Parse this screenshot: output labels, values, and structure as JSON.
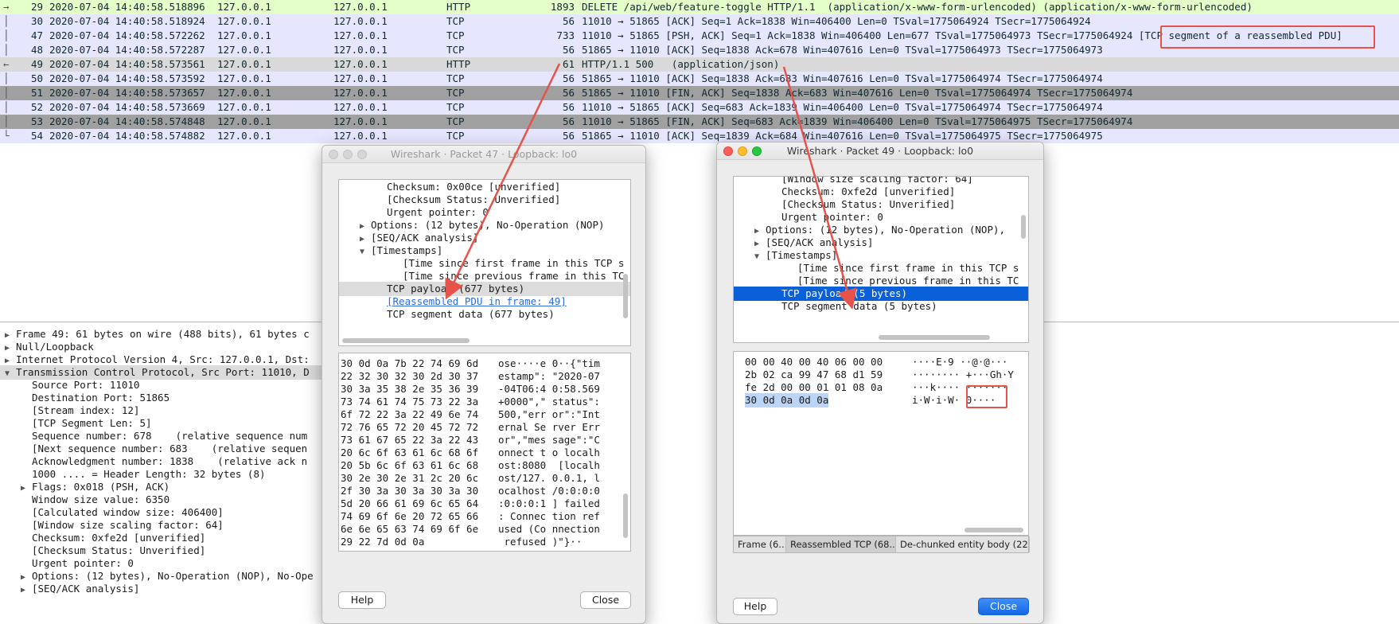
{
  "packets": [
    {
      "no": "29",
      "time": "2020-07-04 14:40:58.518896",
      "src": "127.0.0.1",
      "dst": "127.0.0.1",
      "proto": "HTTP",
      "len": "1893",
      "info": "DELETE /api/web/feature-toggle HTTP/1.1  (application/x-www-form-urlencoded) (application/x-www-form-urlencoded)",
      "bg": "#e4ffc7",
      "fg": "#12272e",
      "rel": "→"
    },
    {
      "no": "30",
      "time": "2020-07-04 14:40:58.518924",
      "src": "127.0.0.1",
      "dst": "127.0.0.1",
      "proto": "TCP",
      "len": "56",
      "info": "11010 → 51865 [ACK] Seq=1 Ack=1838 Win=406400 Len=0 TSval=1775064924 TSecr=1775064924",
      "bg": "#e7e6ff",
      "fg": "#12272e",
      "rel": "│"
    },
    {
      "no": "47",
      "time": "2020-07-04 14:40:58.572262",
      "src": "127.0.0.1",
      "dst": "127.0.0.1",
      "proto": "TCP",
      "len": "733",
      "info": "11010 → 51865 [PSH, ACK] Seq=1 Ack=1838 Win=406400 Len=677 TSval=1775064973 TSecr=1775064924 [TCP segment of a reassembled PDU]",
      "bg": "#e7e6ff",
      "fg": "#12272e",
      "rel": "│"
    },
    {
      "no": "48",
      "time": "2020-07-04 14:40:58.572287",
      "src": "127.0.0.1",
      "dst": "127.0.0.1",
      "proto": "TCP",
      "len": "56",
      "info": "51865 → 11010 [ACK] Seq=1838 Ack=678 Win=407616 Len=0 TSval=1775064973 TSecr=1775064973",
      "bg": "#e7e6ff",
      "fg": "#12272e",
      "rel": "│"
    },
    {
      "no": "49",
      "time": "2020-07-04 14:40:58.573561",
      "src": "127.0.0.1",
      "dst": "127.0.0.1",
      "proto": "HTTP",
      "len": "61",
      "info": "HTTP/1.1 500   (application/json)",
      "bg": "#d9d9d9",
      "fg": "#12272e",
      "rel": "←"
    },
    {
      "no": "50",
      "time": "2020-07-04 14:40:58.573592",
      "src": "127.0.0.1",
      "dst": "127.0.0.1",
      "proto": "TCP",
      "len": "56",
      "info": "51865 → 11010 [ACK] Seq=1838 Ack=683 Win=407616 Len=0 TSval=1775064974 TSecr=1775064974",
      "bg": "#e7e6ff",
      "fg": "#12272e",
      "rel": "│"
    },
    {
      "no": "51",
      "time": "2020-07-04 14:40:58.573657",
      "src": "127.0.0.1",
      "dst": "127.0.0.1",
      "proto": "TCP",
      "len": "56",
      "info": "51865 → 11010 [FIN, ACK] Seq=1838 Ack=683 Win=407616 Len=0 TSval=1775064974 TSecr=1775064974",
      "bg": "#a0a0a0",
      "fg": "#12272e",
      "rel": "│"
    },
    {
      "no": "52",
      "time": "2020-07-04 14:40:58.573669",
      "src": "127.0.0.1",
      "dst": "127.0.0.1",
      "proto": "TCP",
      "len": "56",
      "info": "11010 → 51865 [ACK] Seq=683 Ack=1839 Win=406400 Len=0 TSval=1775064974 TSecr=1775064974",
      "bg": "#e7e6ff",
      "fg": "#12272e",
      "rel": "│"
    },
    {
      "no": "53",
      "time": "2020-07-04 14:40:58.574848",
      "src": "127.0.0.1",
      "dst": "127.0.0.1",
      "proto": "TCP",
      "len": "56",
      "info": "11010 → 51865 [FIN, ACK] Seq=683 Ack=1839 Win=406400 Len=0 TSval=1775064975 TSecr=1775064974",
      "bg": "#a0a0a0",
      "fg": "#12272e",
      "rel": "│"
    },
    {
      "no": "54",
      "time": "2020-07-04 14:40:58.574882",
      "src": "127.0.0.1",
      "dst": "127.0.0.1",
      "proto": "TCP",
      "len": "56",
      "info": "51865 → 11010 [ACK] Seq=1839 Ack=684 Win=407616 Len=0 TSval=1775064975 TSecr=1775064975",
      "bg": "#e7e6ff",
      "fg": "#12272e",
      "rel": "└"
    }
  ],
  "details": [
    {
      "text": "Frame 49: 61 bytes on wire (488 bits), 61 bytes c",
      "tri": "▶",
      "indent": 0
    },
    {
      "text": "Null/Loopback",
      "tri": "▶",
      "indent": 0
    },
    {
      "text": "Internet Protocol Version 4, Src: 127.0.0.1, Dst:",
      "tri": "▶",
      "indent": 0
    },
    {
      "text": "Transmission Control Protocol, Src Port: 11010, D",
      "tri": "▼",
      "indent": 0,
      "sel": true
    },
    {
      "text": "Source Port: 11010",
      "tri": "",
      "indent": 1
    },
    {
      "text": "Destination Port: 51865",
      "tri": "",
      "indent": 1
    },
    {
      "text": "[Stream index: 12]",
      "tri": "",
      "indent": 1
    },
    {
      "text": "[TCP Segment Len: 5]",
      "tri": "",
      "indent": 1
    },
    {
      "text": "Sequence number: 678    (relative sequence num",
      "tri": "",
      "indent": 1
    },
    {
      "text": "[Next sequence number: 683    (relative sequen",
      "tri": "",
      "indent": 1
    },
    {
      "text": "Acknowledgment number: 1838    (relative ack n",
      "tri": "",
      "indent": 1
    },
    {
      "text": "1000 .... = Header Length: 32 bytes (8)",
      "tri": "",
      "indent": 1
    },
    {
      "text": "Flags: 0x018 (PSH, ACK)",
      "tri": "▶",
      "indent": 1
    },
    {
      "text": "Window size value: 6350",
      "tri": "",
      "indent": 1
    },
    {
      "text": "[Calculated window size: 406400]",
      "tri": "",
      "indent": 1
    },
    {
      "text": "[Window size scaling factor: 64]",
      "tri": "",
      "indent": 1
    },
    {
      "text": "Checksum: 0xfe2d [unverified]",
      "tri": "",
      "indent": 1
    },
    {
      "text": "[Checksum Status: Unverified]",
      "tri": "",
      "indent": 1
    },
    {
      "text": "Urgent pointer: 0",
      "tri": "",
      "indent": 1
    },
    {
      "text": "Options: (12 bytes), No-Operation (NOP), No-Ope",
      "tri": "▶",
      "indent": 1
    },
    {
      "text": "[SEQ/ACK analysis]",
      "tri": "▶",
      "indent": 1
    }
  ],
  "dialog47": {
    "title": "Wireshark · Packet 47 · Loopback: lo0",
    "tree": [
      {
        "text": "Checksum: 0x00ce [unverified]",
        "tri": "",
        "indent": 2
      },
      {
        "text": "[Checksum Status: Unverified]",
        "tri": "",
        "indent": 2
      },
      {
        "text": "Urgent pointer: 0",
        "tri": "",
        "indent": 2
      },
      {
        "text": "Options: (12 bytes), No-Operation (NOP)",
        "tri": "▶",
        "indent": 1
      },
      {
        "text": "[SEQ/ACK analysis]",
        "tri": "▶",
        "indent": 1
      },
      {
        "text": "[Timestamps]",
        "tri": "▼",
        "indent": 1
      },
      {
        "text": "[Time since first frame in this TCP s",
        "tri": "",
        "indent": 3
      },
      {
        "text": "[Time since previous frame in this TC",
        "tri": "",
        "indent": 3
      },
      {
        "text": "TCP payload (677 bytes)",
        "tri": "",
        "indent": 2,
        "hl": "grey"
      },
      {
        "text": "[Reassembled PDU in frame: 49]",
        "tri": "",
        "indent": 2,
        "link": true
      },
      {
        "text": "TCP segment data (677 bytes)",
        "tri": "",
        "indent": 2
      }
    ],
    "hex": [
      "30 0d 0a 7b 22 74 69 6d",
      "22 32 30 32 30 2d 30 37",
      "30 3a 35 38 2e 35 36 39",
      "73 74 61 74 75 73 22 3a",
      "6f 72 22 3a 22 49 6e 74",
      "72 76 65 72 20 45 72 72",
      "73 61 67 65 22 3a 22 43",
      "20 6c 6f 63 61 6c 68 6f",
      "20 5b 6c 6f 63 61 6c 68",
      "30 2e 30 2e 31 2c 20 6c",
      "2f 30 3a 30 3a 30 3a 30",
      "5d 20 66 61 69 6c 65 64",
      "74 69 6f 6e 20 72 65 66",
      "6e 6e 65 63 74 69 6f 6e",
      "29 22 7d 0d 0a"
    ],
    "ascii": [
      "ose····e 0··{\"tim",
      "estamp\": \"2020-07",
      "-04T06:4 0:58.569",
      "+0000\",\" status\":",
      "500,\"err or\":\"Int",
      "ernal Se rver Err",
      "or\",\"mes sage\":\"C",
      "onnect t o localh",
      "ost:8080  [localh",
      "ost/127. 0.0.1, l",
      "ocalhost /0:0:0:0",
      ":0:0:0:1 ] failed",
      ": Connec tion ref",
      "used (Co nnection",
      " refused )\"}··"
    ],
    "help": "Help",
    "close": "Close"
  },
  "dialog49": {
    "title": "Wireshark · Packet 49 · Loopback: lo0",
    "tree": [
      {
        "text": "[Window size scaling factor: 64]",
        "tri": "",
        "indent": 2
      },
      {
        "text": "Checksum: 0xfe2d [unverified]",
        "tri": "",
        "indent": 2
      },
      {
        "text": "[Checksum Status: Unverified]",
        "tri": "",
        "indent": 2
      },
      {
        "text": "Urgent pointer: 0",
        "tri": "",
        "indent": 2
      },
      {
        "text": "Options: (12 bytes), No-Operation (NOP),",
        "tri": "▶",
        "indent": 1
      },
      {
        "text": "[SEQ/ACK analysis]",
        "tri": "▶",
        "indent": 1
      },
      {
        "text": "[Timestamps]",
        "tri": "▼",
        "indent": 1
      },
      {
        "text": "[Time since first frame in this TCP s",
        "tri": "",
        "indent": 3
      },
      {
        "text": "[Time since previous frame in this TC",
        "tri": "",
        "indent": 3
      },
      {
        "text": "TCP payload (5 bytes)",
        "tri": "",
        "indent": 2,
        "hl": "blue"
      },
      {
        "text": "TCP segment data (5 bytes)",
        "tri": "",
        "indent": 2
      }
    ],
    "hex": [
      "00 00 40 00 40 06 00 00",
      "2b 02 ca 99 47 68 d1 59",
      "fe 2d 00 00 01 01 08 0a",
      "30 0d 0a 0d 0a"
    ],
    "ascii": [
      "····E·9 ··@·@···",
      "········ +···Gh·Y",
      "···k···· ·······",
      "i·W·i·W· 0····"
    ],
    "tabs": [
      "Frame (6...",
      "Reassembled TCP (68...",
      "De-chunked entity body (22..."
    ],
    "help": "Help",
    "close": "Close"
  },
  "colors": {
    "annotation_red": "#e5534b",
    "selection_blue": "#0a60d8"
  }
}
